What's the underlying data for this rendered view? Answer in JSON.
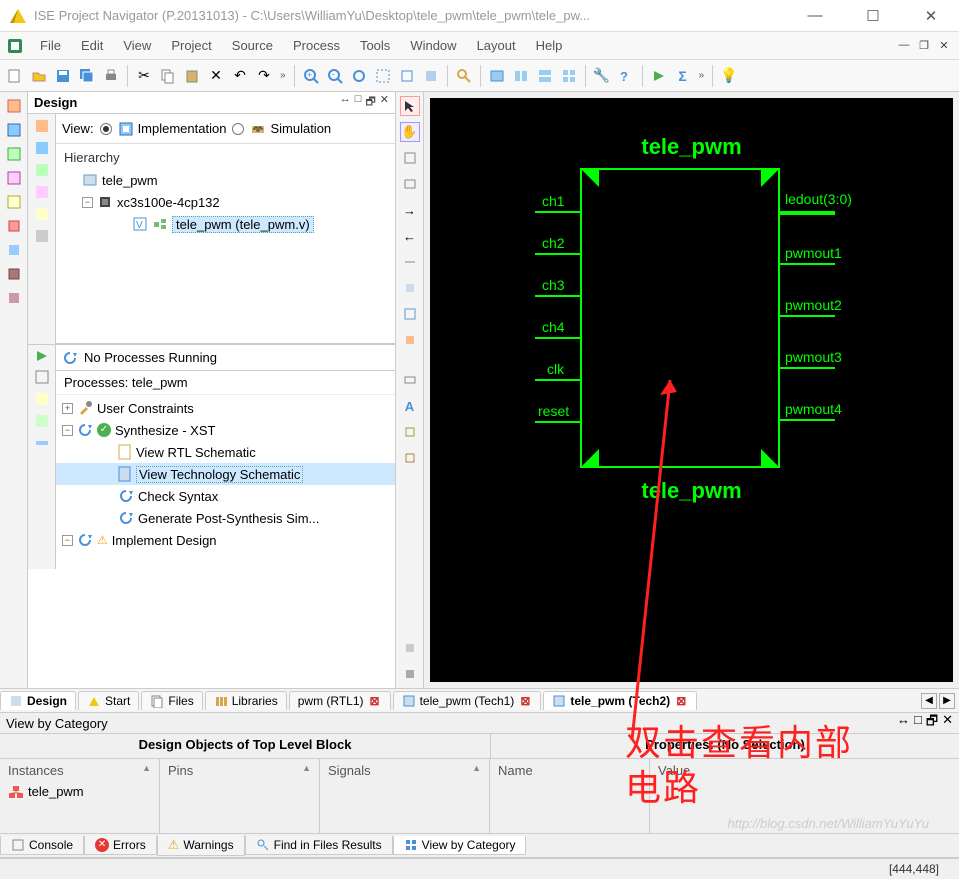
{
  "titlebar": {
    "title": "ISE Project Navigator (P.20131013) - C:\\Users\\WilliamYu\\Desktop\\tele_pwm\\tele_pwm\\tele_pw..."
  },
  "menu": [
    "File",
    "Edit",
    "View",
    "Project",
    "Source",
    "Process",
    "Tools",
    "Window",
    "Layout",
    "Help"
  ],
  "design_panel": {
    "title": "Design",
    "view_label": "View:",
    "impl": "Implementation",
    "sim": "Simulation",
    "hierarchy": "Hierarchy",
    "tree": {
      "proj": "tele_pwm",
      "device": "xc3s100e-4cp132",
      "module": "tele_pwm (tele_pwm.v)"
    },
    "no_proc": "No Processes Running",
    "proc_hdr": "Processes: tele_pwm",
    "procs": {
      "uc": "User Constraints",
      "syn": "Synthesize - XST",
      "vrs": "View RTL Schematic",
      "vts": "View Technology Schematic",
      "cs": "Check Syntax",
      "gps": "Generate Post-Synthesis Sim...",
      "impl": "Implement Design"
    }
  },
  "bottom_tabs_left": {
    "design": "Design",
    "start": "Start",
    "files": "Files",
    "libs": "Libraries"
  },
  "schematic": {
    "title": "tele_pwm",
    "inputs": [
      "ch1",
      "ch2",
      "ch3",
      "ch4",
      "clk",
      "reset"
    ],
    "outputs": [
      "ledout(3:0)",
      "pwmout1",
      "pwmout2",
      "pwmout3",
      "pwmout4"
    ]
  },
  "sch_tabs": {
    "t1": "pwm (RTL1)",
    "t2": "tele_pwm (Tech1)",
    "t3": "tele_pwm (Tech2)"
  },
  "vbc": {
    "hdr": "View by Category",
    "left_title": "Design Objects of Top Level Block",
    "right_title": "Properties: (No Selection)",
    "instances": "Instances",
    "pins": "Pins",
    "signals": "Signals",
    "name": "Name",
    "value": "Value",
    "inst0": "tele_pwm"
  },
  "btabs": {
    "console": "Console",
    "errors": "Errors",
    "warnings": "Warnings",
    "find": "Find in Files Results",
    "vbc": "View by Category"
  },
  "status": {
    "coords": "[444,448]"
  },
  "annotation": "双击查看内部\n电路",
  "watermark": "http://blog.csdn.net/WilliamYuYuYu"
}
